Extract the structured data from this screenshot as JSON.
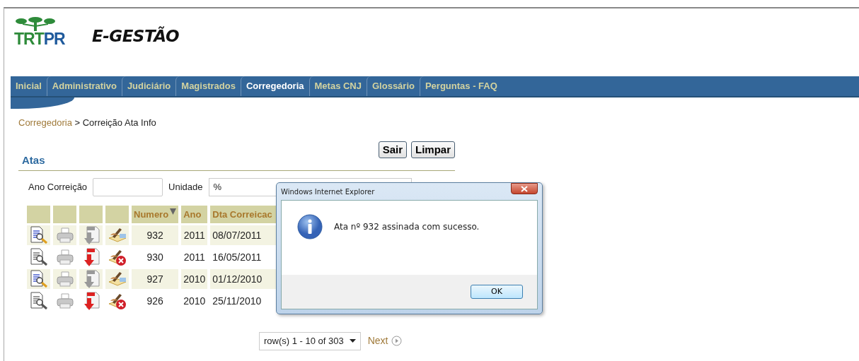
{
  "logo": {
    "parts": [
      "TRT",
      "PR"
    ],
    "title": "E-GESTÃO"
  },
  "nav": [
    {
      "label": "Inicial",
      "selected": false
    },
    {
      "label": "Administrativo",
      "selected": false
    },
    {
      "label": "Judiciário",
      "selected": false
    },
    {
      "label": "Magistrados",
      "selected": false
    },
    {
      "label": "Corregedoria",
      "selected": true
    },
    {
      "label": "Metas CNJ",
      "selected": false
    },
    {
      "label": "Glossário",
      "selected": false
    },
    {
      "label": "Perguntas - FAQ",
      "selected": false
    }
  ],
  "breadcrumb": {
    "link": "Corregedoria",
    "separator": ">",
    "current": "Correição Ata Info"
  },
  "buttons": [
    "Sair",
    "Limpar"
  ],
  "section_title": "Atas",
  "filters": {
    "year_label": "Ano Correição",
    "unit_label": "Unidade",
    "unit_value": "%"
  },
  "table": {
    "columns": [
      "Numero",
      "Ano",
      "Dta Correicac"
    ],
    "rows": [
      {
        "kind": "open",
        "numero": "932",
        "ano": "2011",
        "data": "08/07/2011"
      },
      {
        "kind": "closed",
        "numero": "930",
        "ano": "2011",
        "data": "16/05/2011"
      },
      {
        "kind": "open",
        "numero": "927",
        "ano": "2010",
        "data": "01/12/2010"
      },
      {
        "kind": "closed",
        "numero": "926",
        "ano": "2010",
        "data": "25/11/2010"
      }
    ]
  },
  "pagination": {
    "range": "row(s) 1 - 10 of 303",
    "next": "Next"
  },
  "dialog": {
    "title": "Windows Internet Explorer",
    "message": "Ata nº 932 assinada com sucesso.",
    "button": "OK"
  }
}
